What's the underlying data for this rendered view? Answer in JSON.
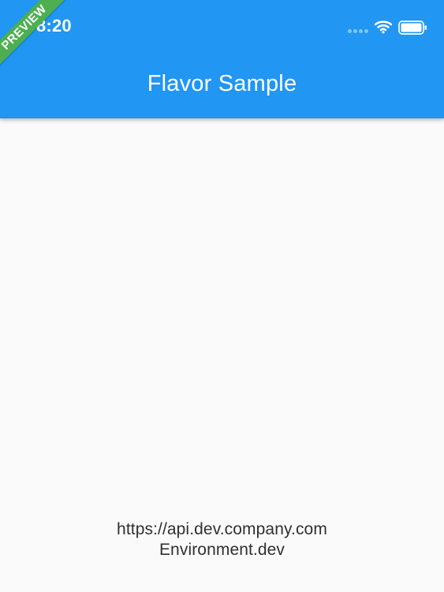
{
  "status_bar": {
    "time": "8:20",
    "icons": [
      "signal-dots-icon",
      "wifi-icon",
      "battery-icon"
    ]
  },
  "banner": {
    "label": "PREVIEW",
    "color": "#4caf50"
  },
  "app_bar": {
    "title": "Flavor Sample",
    "color": "#2196f3"
  },
  "body": {
    "api_url": "https://api.dev.company.com",
    "environment": "Environment.dev",
    "background": "#fafafa"
  }
}
